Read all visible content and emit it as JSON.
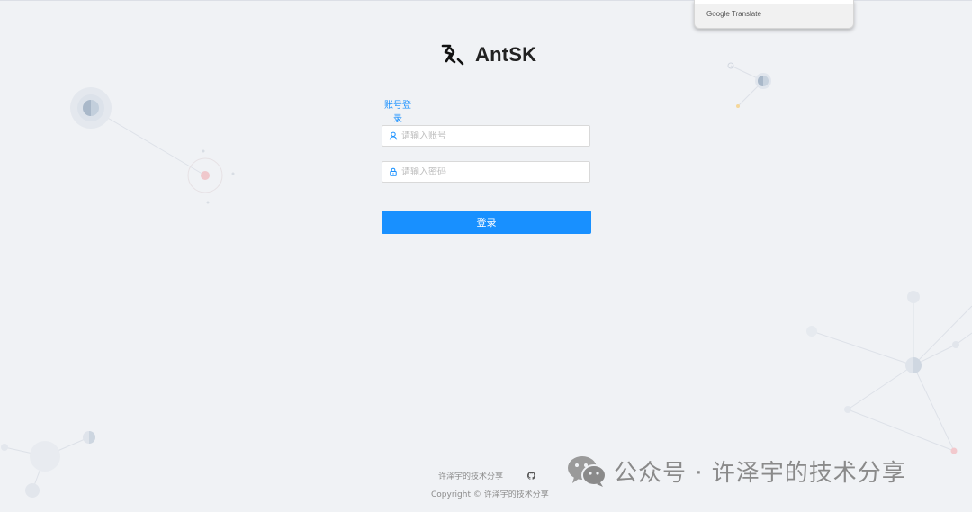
{
  "translate_popup": {
    "label": "Google Translate"
  },
  "brand": {
    "name": "AntSK",
    "primary_color": "#1890ff"
  },
  "login": {
    "tab_label": "账号登录",
    "username_placeholder": "请输入账号",
    "password_placeholder": "请输入密码",
    "submit_label": "登录"
  },
  "footer": {
    "link_label": "许泽宇的技术分享",
    "github_icon": "github-icon",
    "copyright": "Copyright © 许泽宇的技术分享"
  },
  "watermark": {
    "text": "公众号 · 许泽宇的技术分享",
    "icon": "wechat-icon"
  }
}
